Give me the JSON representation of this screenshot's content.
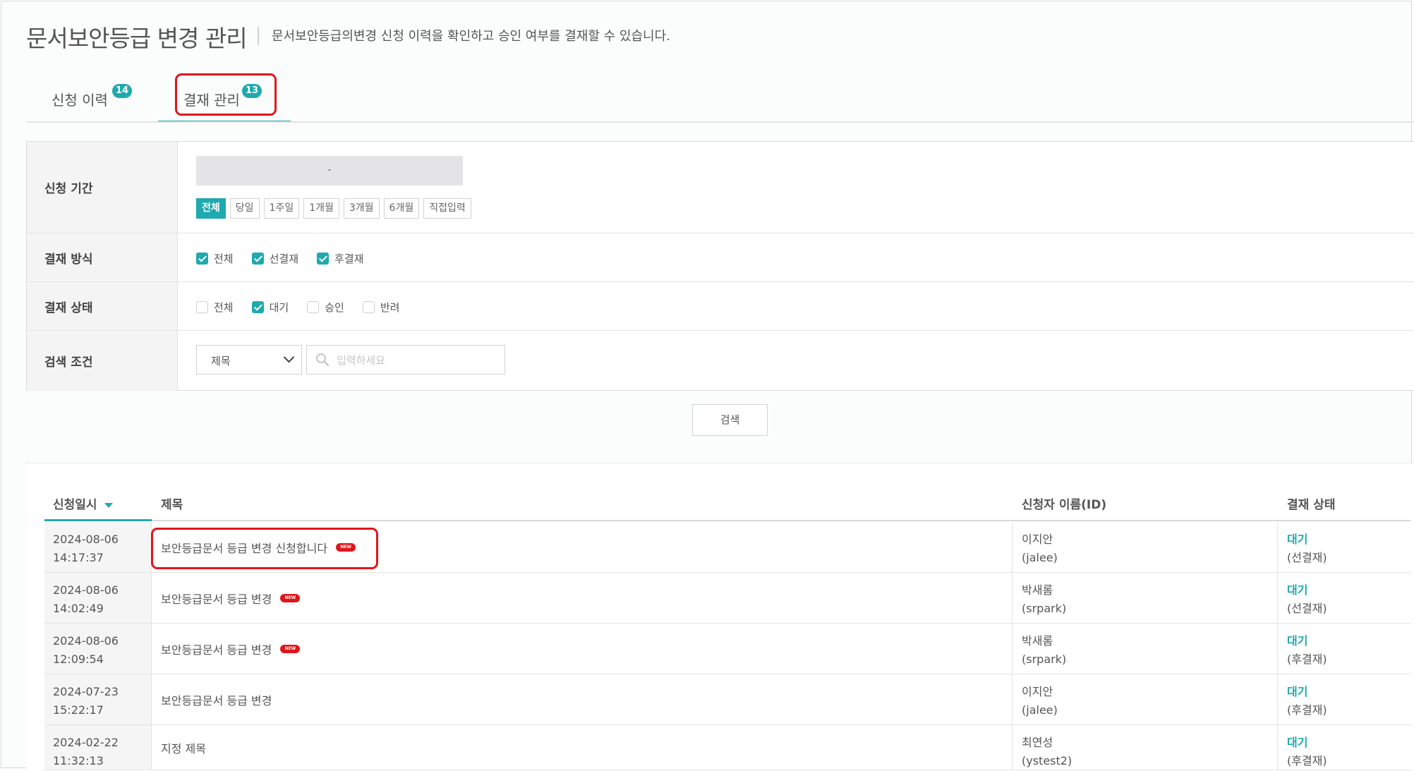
{
  "header": {
    "title": "문서보안등급 변경 관리",
    "description": "문서보안등급의변경 신청 이력을 확인하고 승인 여부를 결재할 수 있습니다."
  },
  "tabs": [
    {
      "label": "신청 이력",
      "badge": "14",
      "active": false
    },
    {
      "label": "결재 관리",
      "badge": "13",
      "active": true
    }
  ],
  "filter": {
    "period": {
      "label": "신청 기간",
      "date_value": "-",
      "buttons": [
        "전체",
        "당일",
        "1주일",
        "1개월",
        "3개월",
        "6개월",
        "직접입력"
      ],
      "selected": "전체"
    },
    "method": {
      "label": "결재 방식",
      "options": [
        {
          "label": "전체",
          "checked": true
        },
        {
          "label": "선결재",
          "checked": true
        },
        {
          "label": "후결재",
          "checked": true
        }
      ]
    },
    "state": {
      "label": "결재 상태",
      "options": [
        {
          "label": "전체",
          "checked": false
        },
        {
          "label": "대기",
          "checked": true
        },
        {
          "label": "승인",
          "checked": false
        },
        {
          "label": "반려",
          "checked": false
        }
      ]
    },
    "condition": {
      "label": "검색 조건",
      "select_value": "제목",
      "placeholder": "입력하세요"
    },
    "search_button": "검색"
  },
  "table": {
    "columns": [
      "신청일시",
      "제목",
      "신청자 이름(ID)",
      "결재 상태"
    ],
    "new_badge": "NEW",
    "rows": [
      {
        "date": "2024-08-06",
        "time": "14:17:37",
        "title": "보안등급문서 등급 변경 신청합니다",
        "is_new": true,
        "name": "이지안",
        "id": "(jalee)",
        "status": "대기",
        "type": "(선결재)"
      },
      {
        "date": "2024-08-06",
        "time": "14:02:49",
        "title": "보안등급문서 등급 변경",
        "is_new": true,
        "name": "박새롬",
        "id": "(srpark)",
        "status": "대기",
        "type": "(선결재)"
      },
      {
        "date": "2024-08-06",
        "time": "12:09:54",
        "title": "보안등급문서 등급 변경",
        "is_new": true,
        "name": "박새롬",
        "id": "(srpark)",
        "status": "대기",
        "type": "(후결재)"
      },
      {
        "date": "2024-07-23",
        "time": "15:22:17",
        "title": "보안등급문서 등급 변경",
        "is_new": false,
        "name": "이지안",
        "id": "(jalee)",
        "status": "대기",
        "type": "(후결재)"
      },
      {
        "date": "2024-02-22",
        "time": "11:32:13",
        "title": "지정 제목",
        "is_new": false,
        "name": "최연성",
        "id": "(ystest2)",
        "status": "대기",
        "type": "(후결재)"
      }
    ]
  },
  "colors": {
    "accent": "#1fa9b0",
    "highlight": "#e0161b"
  }
}
